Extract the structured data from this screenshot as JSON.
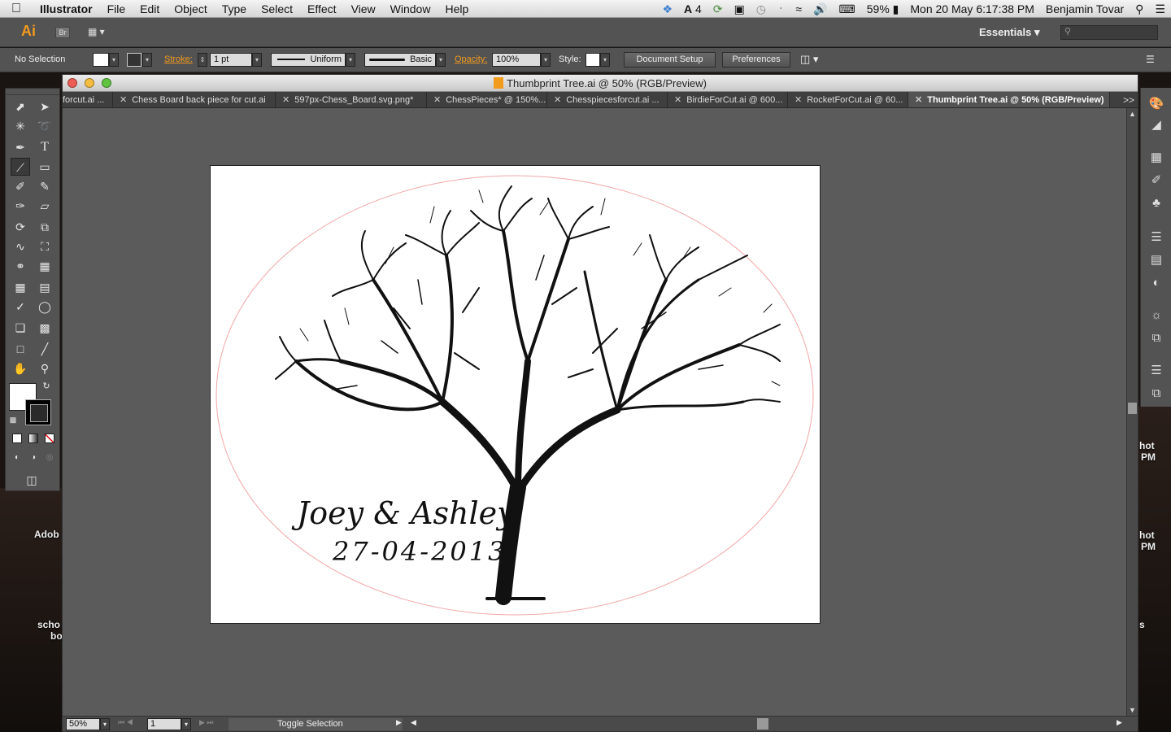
{
  "menubar": {
    "app": "Illustrator",
    "items": [
      "File",
      "Edit",
      "Object",
      "Type",
      "Select",
      "Effect",
      "View",
      "Window",
      "Help"
    ],
    "status": {
      "notifications": "4",
      "battery": "59%",
      "datetime": "Mon 20 May  6:17:38 PM",
      "user": "Benjamin Tovar"
    }
  },
  "appbar": {
    "logo": "Ai",
    "bridge": "Br",
    "workspace": "Essentials",
    "search_placeholder": ""
  },
  "control": {
    "selection": "No Selection",
    "stroke_label": "Stroke:",
    "stroke_weight": "1 pt",
    "profile": "Uniform",
    "brush": "Basic",
    "opacity_label": "Opacity:",
    "opacity": "100%",
    "style_label": "Style:",
    "document_setup": "Document Setup",
    "preferences": "Preferences"
  },
  "document": {
    "title": "Thumbprint Tree.ai @ 50% (RGB/Preview)",
    "tabs": [
      {
        "label": "forcut.ai ..."
      },
      {
        "label": "Chess Board back piece for cut.ai"
      },
      {
        "label": "597px-Chess_Board.svg.png*"
      },
      {
        "label": "ChessPieces* @ 150%..."
      },
      {
        "label": "Chesspiecesforcut.ai ..."
      },
      {
        "label": "BirdieForCut.ai @ 600..."
      },
      {
        "label": "RocketForCut.ai @ 60..."
      },
      {
        "label": "Thumbprint Tree.ai @ 50% (RGB/Preview)"
      }
    ],
    "tab_more": ">>",
    "artwork": {
      "names": "Joey & Ashley",
      "date": "27-04-2013"
    }
  },
  "statusbar": {
    "zoom": "50%",
    "page": "1",
    "status": "Toggle Selection"
  },
  "desktop": {
    "labels_left": [
      "Adob",
      "scho",
      "bo"
    ],
    "labels_right": [
      "hot",
      "PM",
      "hot",
      "PM",
      "s"
    ]
  },
  "colors": {
    "accent": "#f29b1d",
    "ellipse": "#f2a7a7"
  }
}
